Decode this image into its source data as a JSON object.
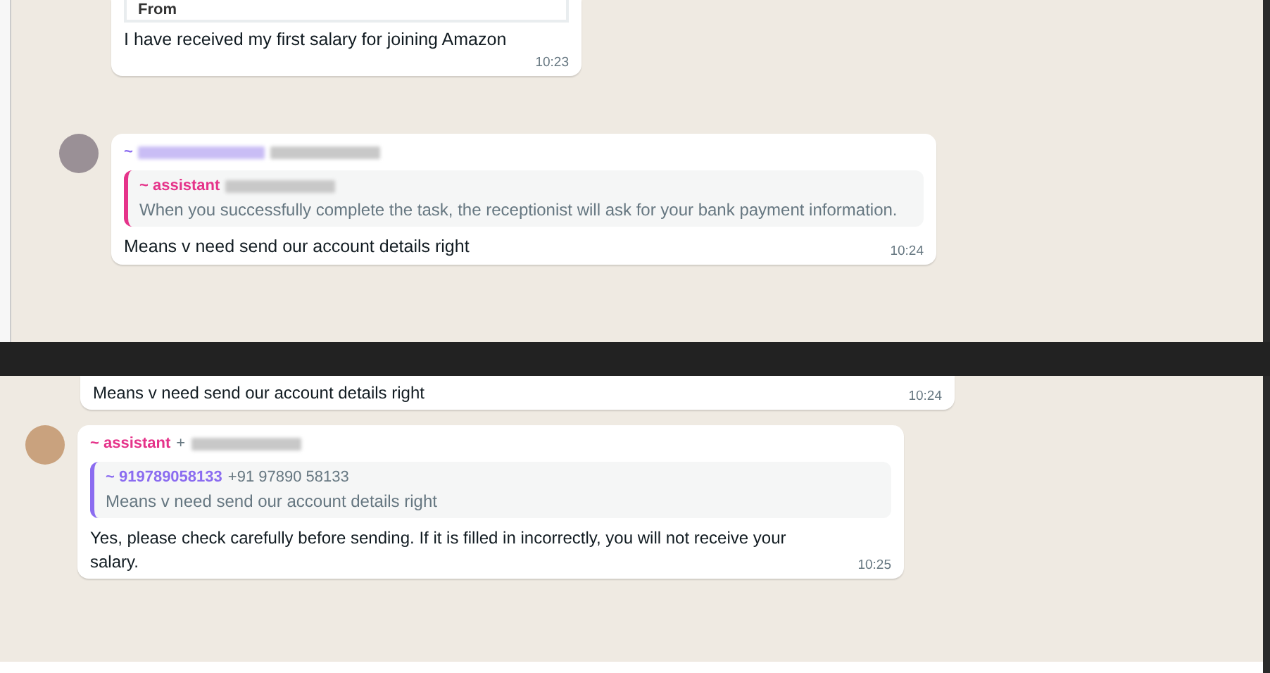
{
  "panels": [
    {
      "messages": [
        {
          "kind": "partial",
          "quote_card": {
            "label": "From"
          },
          "text": "I have received my first salary for joining Amazon",
          "time": "10:23"
        },
        {
          "kind": "full",
          "avatar": true,
          "sender": {
            "name": "~",
            "name_redacted": true,
            "phone_redacted": true,
            "color": "#8b6cf0"
          },
          "quote": {
            "author": "~ assistant",
            "phone_redacted": true,
            "color": "#e5338a",
            "text": "When you successfully complete the task, the receptionist will ask for your bank payment information."
          },
          "text": "Means v need send our account details right",
          "time": "10:24"
        }
      ]
    },
    {
      "messages": [
        {
          "kind": "partial",
          "text": "Means v need send our account details right",
          "time": "10:24"
        },
        {
          "kind": "full",
          "avatar": true,
          "sender": {
            "name": "~ assistant",
            "phone": "+",
            "phone_redacted": true,
            "color": "#e5338a"
          },
          "quote": {
            "author": "~ 919789058133",
            "phone": "+91 97890 58133",
            "color": "#8b6cf0",
            "text": "Means v need send our account details right"
          },
          "text": "Yes, please check carefully before sending. If it is filled in incorrectly, you will not receive your salary.",
          "time": "10:25"
        }
      ]
    }
  ]
}
